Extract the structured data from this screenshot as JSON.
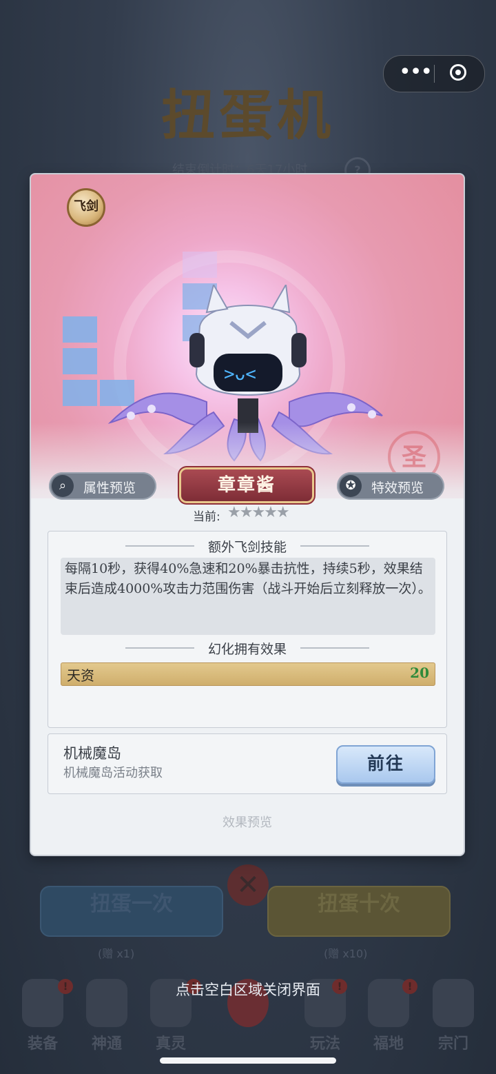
{
  "background": {
    "title": "扭蛋机",
    "countdown": "结束倒计时：6天17小时",
    "help": "?",
    "spin_once": "扭蛋一次",
    "spin_ten": "扭蛋十次",
    "cost_once": "(赠 x1)",
    "cost_ten": "(赠 x10)",
    "nav": [
      {
        "label": "装备",
        "badge": "!"
      },
      {
        "label": "神通",
        "badge": ""
      },
      {
        "label": "真灵",
        "badge": "!"
      },
      {
        "label": "",
        "badge": ""
      },
      {
        "label": "玩法",
        "badge": "!"
      },
      {
        "label": "福地",
        "badge": "!"
      },
      {
        "label": "宗门",
        "badge": ""
      }
    ]
  },
  "capsule": {
    "more": "•••"
  },
  "card": {
    "type_badge": "飞剑",
    "seal": "圣",
    "attr_preview": "属性预览",
    "effect_preview_btn": "特效预览",
    "name": "章章酱",
    "current_label": "当前:",
    "stars": "★★★★★",
    "star_rating": 0,
    "skill_section_title": "额外飞剑技能",
    "skill_desc": "每隔10秒，获得40%急速和20%暴击抗性，持续5秒，效果结束后造成4000%攻击力范围伤害（战斗开始后立刻释放一次）。",
    "own_section_title": "幻化拥有效果",
    "talent_label": "天资",
    "talent_value": "20",
    "source_name": "机械魔岛",
    "source_desc": "机械魔岛活动获取",
    "goto_label": "前往",
    "effect_preview_link": "效果预览"
  },
  "close_hint": "点击空白区域关闭界面",
  "colors": {
    "accent_red": "#8f2f39",
    "talent_gold": "#cfae6c",
    "talent_value_green": "#2f8a3a",
    "goto_blue": "#a9c8ee"
  }
}
